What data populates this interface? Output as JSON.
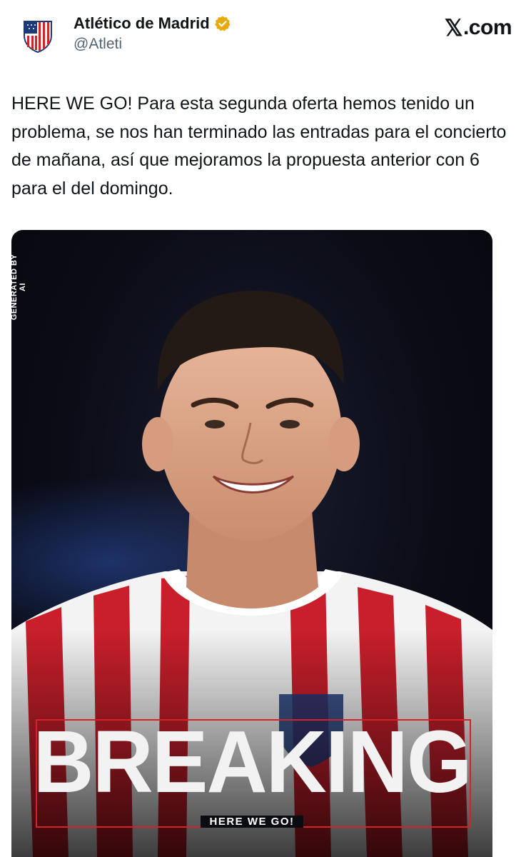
{
  "header": {
    "account_name": "Atlético de Madrid",
    "handle": "@Atleti",
    "site": ".com",
    "site_mark": "𝕏",
    "avatar_icon": "atletico-crest-icon",
    "verified_icon": "verified-badge-icon",
    "verified_color": "#e8a90c"
  },
  "tweet": {
    "text": "HERE WE GO! Para esta segunda oferta hemos tenido un problema, se nos han terminado las entradas para el concierto de mañana, así que mejoramos la propuesta anterior con 6 para el del domingo."
  },
  "media": {
    "side_label": "GENERATED BY AI",
    "headline": "BREAKING",
    "subline": "HERE WE GO!",
    "accent_color": "#d2232a"
  }
}
